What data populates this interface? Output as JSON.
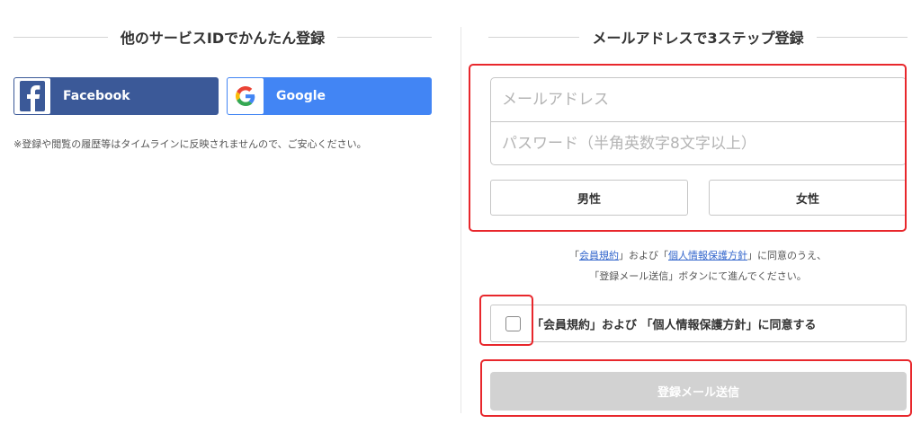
{
  "left": {
    "heading": "他のサービスIDでかんたん登録",
    "facebook": {
      "label": "Facebook",
      "icon": "facebook-icon",
      "color": "#3b5998"
    },
    "google": {
      "label": "Google",
      "icon": "google-icon",
      "color": "#4285f4"
    },
    "note": "※登録や閲覧の履歴等はタイムラインに反映されませんので、ご安心ください。"
  },
  "right": {
    "heading": "メールアドレスで3ステップ登録",
    "email": {
      "value": "",
      "placeholder": "メールアドレス"
    },
    "password": {
      "value": "",
      "placeholder": "パスワード（半角英数字8文字以上）"
    },
    "gender": {
      "male": "男性",
      "female": "女性"
    },
    "agreement_line1": {
      "open1": "「",
      "terms_link": "会員規約",
      "mid": "」および「",
      "privacy_link": "個人情報保護方針",
      "close": "」に同意のうえ、"
    },
    "agreement_line2": "「登録メール送信」ボタンにて進んでください。",
    "checkbox_label": "「会員規約」および 「個人情報保護方針」に同意する",
    "submit": "登録メール送信"
  },
  "colors": {
    "highlight": "#e8272c",
    "link": "#3366cc",
    "disabled_button": "#d2d2d2"
  }
}
